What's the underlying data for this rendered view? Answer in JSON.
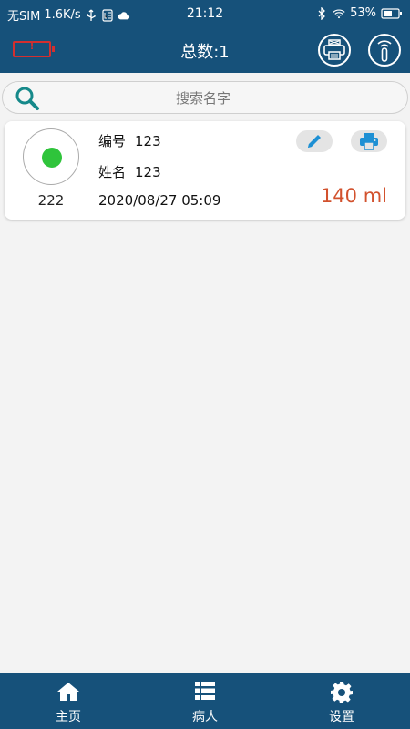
{
  "status_bar": {
    "carrier": "无SIM",
    "speed": "1.6K/s",
    "time": "21:12",
    "battery": "53%"
  },
  "header": {
    "title": "总数:1",
    "warning_glyph": "!"
  },
  "search": {
    "placeholder": "搜索名字",
    "value": ""
  },
  "patients": [
    {
      "id": "222",
      "status_color": "#2fc43b",
      "number_label": "编号",
      "number": "123",
      "name_label": "姓名",
      "name": "123",
      "datetime": "2020/08/27 05:09",
      "volume": "140 ml"
    }
  ],
  "nav": {
    "home": "主页",
    "patients": "病人",
    "settings": "设置"
  },
  "colors": {
    "primary": "#16517a",
    "accent": "#1e90d4",
    "volume": "#d2522e",
    "status_ok": "#2fc43b",
    "warning": "#d32f2f"
  }
}
